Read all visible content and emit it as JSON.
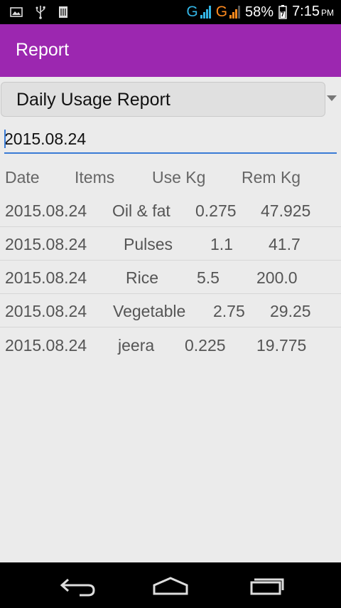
{
  "status_bar": {
    "network_1": "G",
    "network_2": "G",
    "battery": "58%",
    "time": "7:15",
    "ampm": "PM",
    "icons": [
      "image-icon",
      "usb-icon",
      "sim-icon",
      "signal-icon",
      "battery-icon"
    ]
  },
  "app_bar": {
    "title": "Report"
  },
  "spinner": {
    "selected": "Daily Usage Report"
  },
  "date_input": {
    "value": "2015.08.24"
  },
  "table": {
    "headers": [
      "Date",
      "Items",
      "Use Kg",
      "Rem Kg"
    ],
    "rows": [
      [
        "2015.08.24",
        "Oil & fat",
        "0.275",
        "47.925"
      ],
      [
        "2015.08.24",
        "Pulses",
        "1.1",
        "41.7"
      ],
      [
        "2015.08.24",
        "Rice",
        "5.5",
        "200.0"
      ],
      [
        "2015.08.24",
        "Vegetable",
        "2.75",
        "29.25"
      ],
      [
        "2015.08.24",
        "jeera",
        "0.225",
        "19.775"
      ]
    ]
  },
  "nav_bar": {
    "icons": [
      "back-icon",
      "home-icon",
      "recents-icon"
    ]
  },
  "colors": {
    "app_bar": "#9c27b0",
    "accent": "#3a7bd5"
  }
}
